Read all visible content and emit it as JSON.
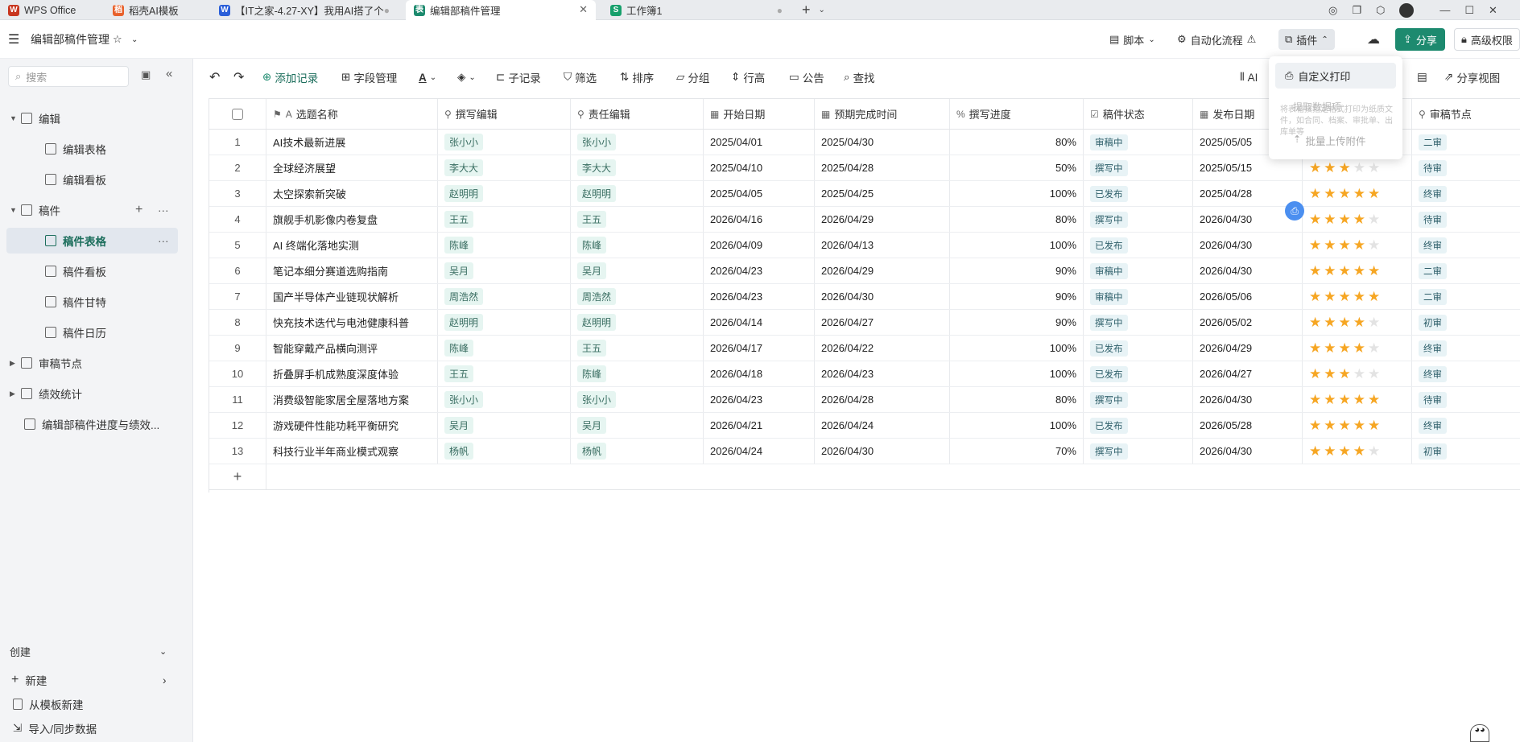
{
  "tabs": [
    {
      "label": "WPS Office",
      "icon": "W",
      "color": "#c8361f"
    },
    {
      "label": "稻壳AI模板",
      "icon": "稻",
      "color": "#e8612c"
    },
    {
      "label": "【IT之家-4.27-XY】我用AI搭了个",
      "icon": "W",
      "color": "#2b5fd9"
    },
    {
      "label": "编辑部稿件管理",
      "icon": "表",
      "color": "#1c8a6e"
    },
    {
      "label": "工作簿1",
      "icon": "S",
      "color": "#17a06c"
    }
  ],
  "header": {
    "doc_title": "编辑部稿件管理",
    "script": "脚本",
    "automation": "自动化流程",
    "plugin": "插件",
    "share": "分享",
    "permission": "高级权限"
  },
  "sidebar": {
    "search_placeholder": "搜索",
    "items": [
      {
        "label": "编辑",
        "level": 0,
        "type": "folder"
      },
      {
        "label": "编辑表格",
        "level": 1,
        "type": "grid"
      },
      {
        "label": "编辑看板",
        "level": 1,
        "type": "board"
      },
      {
        "label": "稿件",
        "level": 0,
        "type": "folder"
      },
      {
        "label": "稿件表格",
        "level": 1,
        "type": "grid"
      },
      {
        "label": "稿件看板",
        "level": 1,
        "type": "board"
      },
      {
        "label": "稿件甘特",
        "level": 1,
        "type": "gantt"
      },
      {
        "label": "稿件日历",
        "level": 1,
        "type": "calendar"
      },
      {
        "label": "审稿节点",
        "level": 0,
        "type": "folder"
      },
      {
        "label": "绩效统计",
        "level": 0,
        "type": "folder"
      },
      {
        "label": "编辑部稿件进度与绩效...",
        "level": 0,
        "type": "dashboard"
      }
    ],
    "create_label": "创建",
    "new_label": "新建",
    "from_template": "从模板新建",
    "import_label": "导入/同步数据"
  },
  "toolbar": {
    "add_record": "添加记录",
    "field_manage": "字段管理",
    "sub_record": "子记录",
    "filter": "筛选",
    "sort": "排序",
    "group": "分组",
    "row_height": "行高",
    "notice": "公告",
    "find": "查找",
    "ai": "AI",
    "share_view": "分享视图"
  },
  "popup": {
    "custom_print": "自定义打印",
    "hint": "将表格按指定格式打印为纸质文件，如合同、档案、审批单、出库单等",
    "extract": "提取数据项",
    "batch_upload": "批量上传附件"
  },
  "columns": [
    "选题名称",
    "撰写编辑",
    "责任编辑",
    "开始日期",
    "预期完成时间",
    "撰写进度",
    "稿件状态",
    "发布日期",
    "",
    "审稿节点"
  ],
  "rows": [
    {
      "n": "1",
      "title": "AI技术最新进展",
      "writer": "张小小",
      "editor": "张小小",
      "start": "2025/04/01",
      "due": "2025/04/30",
      "progress": "80%",
      "status": "审稿中",
      "pub": "2025/05/05",
      "stars": 0,
      "node": "二审"
    },
    {
      "n": "2",
      "title": "全球经济展望",
      "writer": "李大大",
      "editor": "李大大",
      "start": "2025/04/10",
      "due": "2025/04/28",
      "progress": "50%",
      "status": "撰写中",
      "pub": "2025/05/15",
      "stars": 3,
      "node": "待审"
    },
    {
      "n": "3",
      "title": "太空探索新突破",
      "writer": "赵明明",
      "editor": "赵明明",
      "start": "2025/04/05",
      "due": "2025/04/25",
      "progress": "100%",
      "status": "已发布",
      "pub": "2025/04/28",
      "stars": 5,
      "node": "终审"
    },
    {
      "n": "4",
      "title": "旗舰手机影像内卷复盘",
      "writer": "王五",
      "editor": "王五",
      "start": "2026/04/16",
      "due": "2026/04/29",
      "progress": "80%",
      "status": "撰写中",
      "pub": "2026/04/30",
      "stars": 4,
      "node": "待审"
    },
    {
      "n": "5",
      "title": "AI 终端化落地实测",
      "writer": "陈峰",
      "editor": "陈峰",
      "start": "2026/04/09",
      "due": "2026/04/13",
      "progress": "100%",
      "status": "已发布",
      "pub": "2026/04/30",
      "stars": 4,
      "node": "终审"
    },
    {
      "n": "6",
      "title": "笔记本细分赛道选购指南",
      "writer": "吴月",
      "editor": "吴月",
      "start": "2026/04/23",
      "due": "2026/04/29",
      "progress": "90%",
      "status": "审稿中",
      "pub": "2026/04/30",
      "stars": 5,
      "node": "二审"
    },
    {
      "n": "7",
      "title": "国产半导体产业链现状解析",
      "writer": "周浩然",
      "editor": "周浩然",
      "start": "2026/04/23",
      "due": "2026/04/30",
      "progress": "90%",
      "status": "审稿中",
      "pub": "2026/05/06",
      "stars": 5,
      "node": "二审"
    },
    {
      "n": "8",
      "title": "快充技术迭代与电池健康科普",
      "writer": "赵明明",
      "editor": "赵明明",
      "start": "2026/04/14",
      "due": "2026/04/27",
      "progress": "90%",
      "status": "撰写中",
      "pub": "2026/05/02",
      "stars": 4,
      "node": "初审"
    },
    {
      "n": "9",
      "title": "智能穿戴产品横向测评",
      "writer": "陈峰",
      "editor": "王五",
      "start": "2026/04/17",
      "due": "2026/04/22",
      "progress": "100%",
      "status": "已发布",
      "pub": "2026/04/29",
      "stars": 4,
      "node": "终审"
    },
    {
      "n": "10",
      "title": "折叠屏手机成熟度深度体验",
      "writer": "王五",
      "editor": "陈峰",
      "start": "2026/04/18",
      "due": "2026/04/23",
      "progress": "100%",
      "status": "已发布",
      "pub": "2026/04/27",
      "stars": 3,
      "node": "终审"
    },
    {
      "n": "11",
      "title": "消费级智能家居全屋落地方案",
      "writer": "张小小",
      "editor": "张小小",
      "start": "2026/04/23",
      "due": "2026/04/28",
      "progress": "80%",
      "status": "撰写中",
      "pub": "2026/04/30",
      "stars": 5,
      "node": "待审"
    },
    {
      "n": "12",
      "title": "游戏硬件性能功耗平衡研究",
      "writer": "吴月",
      "editor": "吴月",
      "start": "2026/04/21",
      "due": "2026/04/24",
      "progress": "100%",
      "status": "已发布",
      "pub": "2026/05/28",
      "stars": 5,
      "node": "终审"
    },
    {
      "n": "13",
      "title": "科技行业半年商业模式观察",
      "writer": "杨帆",
      "editor": "杨帆",
      "start": "2026/04/24",
      "due": "2026/04/30",
      "progress": "70%",
      "status": "撰写中",
      "pub": "2026/04/30",
      "stars": 4,
      "node": "初审"
    }
  ]
}
